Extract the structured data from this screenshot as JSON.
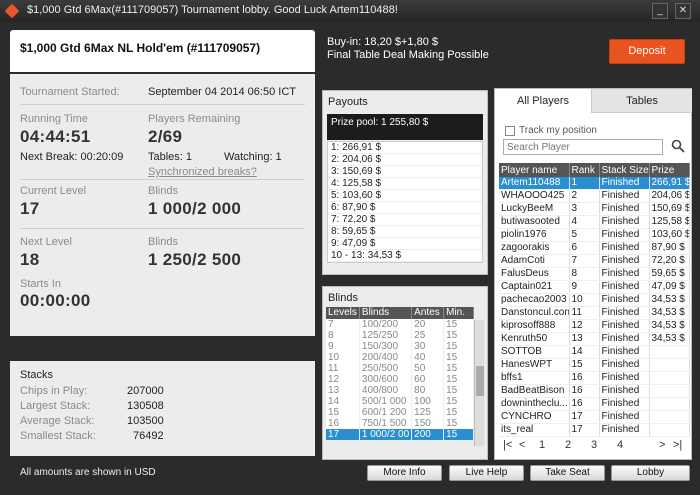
{
  "window": {
    "title": "$1,000 Gtd 6Max(#111709057) Tournament lobby. Good Luck Artem110488!",
    "minimize": "_",
    "close": "✕"
  },
  "header": {
    "tournament_name": "$1,000 Gtd 6Max NL Hold'em (#111709057)",
    "buyin": "Buy-in: 18,20 $+1,80 $",
    "deal_note": "Final Table Deal Making Possible",
    "deposit_label": "Deposit"
  },
  "info": {
    "started_label": "Tournament Started:",
    "started_value": "September 04 2014   06:50 ICT",
    "running_label": "Running Time",
    "running_value": "04:44:51",
    "next_break": "Next Break: 00:20:09",
    "remaining_label": "Players Remaining",
    "remaining_value": "2/69",
    "tables": "Tables: 1",
    "watching": "Watching: 1",
    "sync_breaks": "Synchronized breaks?",
    "current_level_label": "Current Level",
    "current_level_value": "17",
    "current_blinds_label": "Blinds",
    "current_blinds_value": "1 000/2 000",
    "next_level_label": "Next Level",
    "next_level_value": "18",
    "next_blinds_label": "Blinds",
    "next_blinds_value": "1 250/2 500",
    "starts_in_label": "Starts In",
    "starts_in_value": "00:00:00"
  },
  "stacks": {
    "title": "Stacks",
    "rows": [
      {
        "label": "Chips in Play:",
        "value": "207000"
      },
      {
        "label": "Largest Stack:",
        "value": "130508"
      },
      {
        "label": "Average Stack:",
        "value": "103500"
      },
      {
        "label": "Smallest Stack:",
        "value": "76492"
      }
    ]
  },
  "footer_note": "All amounts are shown in USD",
  "payouts": {
    "title": "Payouts",
    "prize_pool": "Prize pool: 1 255,80 $",
    "rows": [
      "1: 266,91 $",
      "2: 204,06 $",
      "3: 150,69 $",
      "4: 125,58 $",
      "5: 103,60 $",
      "6: 87,90 $",
      "7: 72,20 $",
      "8: 59,65 $",
      "9: 47,09 $",
      "10 - 13: 34,53 $"
    ]
  },
  "blinds": {
    "title": "Blinds",
    "headers": [
      "Levels",
      "Blinds",
      "Antes",
      "Min."
    ],
    "rows": [
      [
        "7",
        "100/200",
        "20",
        "15"
      ],
      [
        "8",
        "125/250",
        "25",
        "15"
      ],
      [
        "9",
        "150/300",
        "30",
        "15"
      ],
      [
        "10",
        "200/400",
        "40",
        "15"
      ],
      [
        "11",
        "250/500",
        "50",
        "15"
      ],
      [
        "12",
        "300/600",
        "60",
        "15"
      ],
      [
        "13",
        "400/800",
        "80",
        "15"
      ],
      [
        "14",
        "500/1 000",
        "100",
        "15"
      ],
      [
        "15",
        "600/1 200",
        "125",
        "15"
      ],
      [
        "16",
        "750/1 500",
        "150",
        "15"
      ],
      [
        "17",
        "1 000/2 00",
        "200",
        "15"
      ]
    ]
  },
  "players": {
    "tab_all": "All Players",
    "tab_tables": "Tables",
    "track_label": "Track my position",
    "search_placeholder": "Search Player",
    "headers": [
      "Player name",
      "Rank",
      "Stack Size",
      "Prize"
    ],
    "rows": [
      [
        "Artem110488",
        "1",
        "Finished",
        "266,91 $"
      ],
      [
        "WHAOOO425",
        "2",
        "Finished",
        "204,06 $"
      ],
      [
        "LuckyBeeM",
        "3",
        "Finished",
        "150,69 $"
      ],
      [
        "butiwasooted",
        "4",
        "Finished",
        "125,58 $"
      ],
      [
        "piolin1976",
        "5",
        "Finished",
        "103,60 $"
      ],
      [
        "zagoorakis",
        "6",
        "Finished",
        "87,90 $"
      ],
      [
        "AdamCoti",
        "7",
        "Finished",
        "72,20 $"
      ],
      [
        "FalusDeus",
        "8",
        "Finished",
        "59,65 $"
      ],
      [
        "Captain021",
        "9",
        "Finished",
        "47,09 $"
      ],
      [
        "pachecao2003",
        "10",
        "Finished",
        "34,53 $"
      ],
      [
        "Danstoncul.con",
        "11",
        "Finished",
        "34,53 $"
      ],
      [
        "kiprosoff888",
        "12",
        "Finished",
        "34,53 $"
      ],
      [
        "Kenruth50",
        "13",
        "Finished",
        "34,53 $"
      ],
      [
        "SOTTOB",
        "14",
        "Finished",
        ""
      ],
      [
        "HanesWPT",
        "15",
        "Finished",
        ""
      ],
      [
        "bffs1",
        "16",
        "Finished",
        ""
      ],
      [
        "BadBeatBison",
        "16",
        "Finished",
        ""
      ],
      [
        "downintheclu...",
        "16",
        "Finished",
        ""
      ],
      [
        "CYNCHRO",
        "17",
        "Finished",
        ""
      ],
      [
        "its_real",
        "17",
        "Finished",
        ""
      ]
    ],
    "pager": {
      "first": "|<",
      "prev": "<",
      "pages": [
        "1",
        "2",
        "3",
        "4"
      ],
      "next": ">",
      "last": ">|"
    }
  },
  "buttons": {
    "more_info": "More Info",
    "live_help": "Live Help",
    "take_seat": "Take Seat",
    "lobby": "Lobby"
  }
}
